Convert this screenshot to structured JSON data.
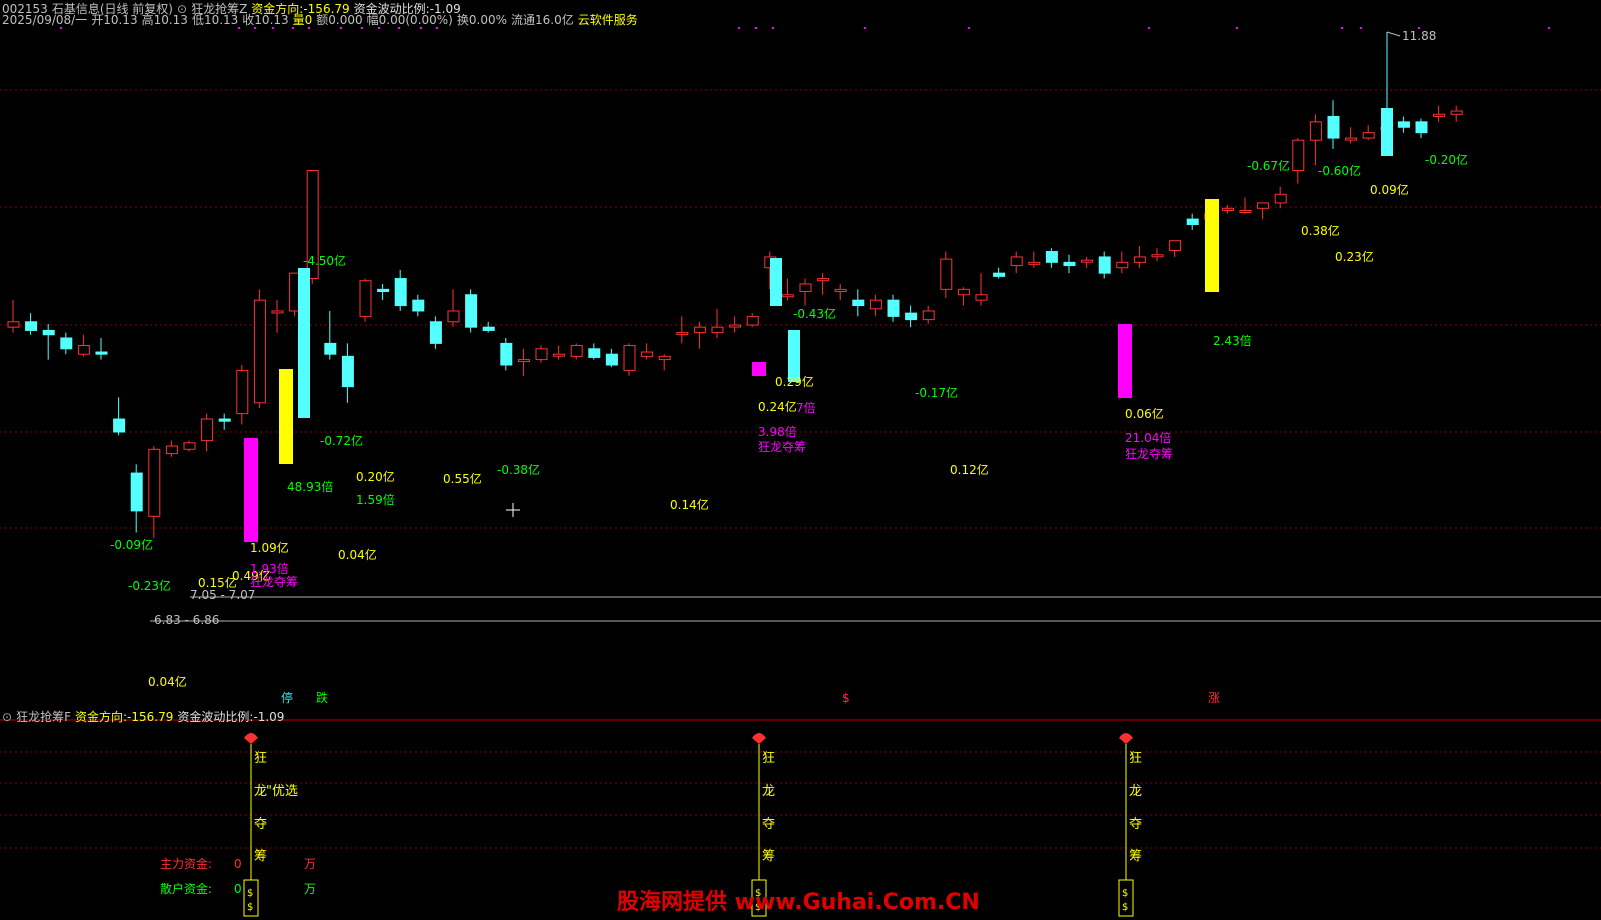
{
  "header": {
    "code": "002153",
    "name": "石基信息(日线 前复权)",
    "indicator": "狂龙抢筹Z",
    "fund_dir_label": "资金方向:",
    "fund_dir_value": "-156.79",
    "fund_wave_label": "资金波动比例:",
    "fund_wave_value": "-1.09",
    "date": "2025/09/08/一",
    "open": "开10.13",
    "high": "高10.13",
    "low": "低10.13",
    "close": "收10.13",
    "vol": "量0",
    "amount": "额0.000",
    "change": "幅0.00(0.00%)",
    "turnover": "换0.00%",
    "float": "流通16.0亿",
    "service": "云软件服务"
  },
  "sub_header": {
    "indicator": "狂龙抢筹F",
    "fund_dir_label": "资金方向:",
    "fund_dir_value": "-156.79",
    "fund_wave_label": "资金波动比例:",
    "fund_wave_value": "-1.09"
  },
  "price_labels": {
    "max": "11.88",
    "range_high": "7.05 - 7.07",
    "range_low": "6.83 - 6.86",
    "min_label": "0.04亿"
  },
  "annotations": [
    {
      "text": "-0.09亿",
      "color": "#00ff00"
    },
    {
      "text": "-0.23亿",
      "color": "#00ff00"
    },
    {
      "text": "0.15亿",
      "color": "#ffff00"
    },
    {
      "text": "0.49亿",
      "color": "#ffff00"
    },
    {
      "text": "1.09亿",
      "color": "#ffff00"
    },
    {
      "text": "1.93倍",
      "color": "#ff00ff"
    },
    {
      "text": "狂龙夺筹",
      "color": "#ff00ff"
    },
    {
      "text": "48.93倍",
      "color": "#00ff00"
    },
    {
      "text": "-4.50亿",
      "color": "#00ff00"
    },
    {
      "text": "-0.72亿",
      "color": "#00ff00"
    },
    {
      "text": "0.20亿",
      "color": "#ffff00"
    },
    {
      "text": "1.59倍",
      "color": "#00ff00"
    },
    {
      "text": "0.04亿",
      "color": "#ffff00"
    },
    {
      "text": "0.55亿",
      "color": "#ffff00"
    },
    {
      "text": "-0.38亿",
      "color": "#00ff00"
    },
    {
      "text": "0.14亿",
      "color": "#ffff00"
    },
    {
      "text": "-0.43亿",
      "color": "#00ff00"
    },
    {
      "text": "0.29亿",
      "color": "#ffff00"
    },
    {
      "text": "0.24亿",
      "color": "#ffff00"
    },
    {
      "text": "7倍",
      "color": "#ff00ff"
    },
    {
      "text": "3.98倍",
      "color": "#ff00ff"
    },
    {
      "text": "狂龙夺筹",
      "color": "#ff00ff"
    },
    {
      "text": "-0.17亿",
      "color": "#00ff00"
    },
    {
      "text": "0.12亿",
      "color": "#ffff00"
    },
    {
      "text": "0.06亿",
      "color": "#ffff00"
    },
    {
      "text": "21.04倍",
      "color": "#ff00ff"
    },
    {
      "text": "狂龙夺筹",
      "color": "#ff00ff"
    },
    {
      "text": "2.43倍",
      "color": "#00ff00"
    },
    {
      "text": "-0.67亿",
      "color": "#00ff00"
    },
    {
      "text": "0.38亿",
      "color": "#ffff00"
    },
    {
      "text": "0.23亿",
      "color": "#ffff00"
    },
    {
      "text": "-0.60亿",
      "color": "#00ff00"
    },
    {
      "text": "0.09亿",
      "color": "#ffff00"
    },
    {
      "text": "-0.20亿",
      "color": "#00ff00"
    },
    {
      "text": "0.04亿",
      "color": "#ffff00"
    }
  ],
  "axis_marks": [
    {
      "text": "停",
      "color": "#40e0e0"
    },
    {
      "text": "跌",
      "color": "#00ff00"
    },
    {
      "text": "$",
      "color": "#ff3030"
    },
    {
      "text": "涨",
      "color": "#ff3030"
    }
  ],
  "signals": [
    {
      "chars": [
        "狂",
        "龙",
        "夺",
        "筹"
      ],
      "extra": "\"优选"
    },
    {
      "chars": [
        "狂",
        "龙",
        "夺",
        "筹"
      ],
      "extra": ""
    },
    {
      "chars": [
        "狂",
        "龙",
        "夺",
        "筹"
      ],
      "extra": ""
    }
  ],
  "funds": {
    "main_label": "主力资金:",
    "main_value": "0",
    "main_unit": "万",
    "retail_label": "散户资金:",
    "retail_value": "0",
    "retail_unit": "万"
  },
  "watermark": "股海网提供 www.Guhai.Com.CN",
  "colors": {
    "up": "#ff3232",
    "down": "#54ffff",
    "yellow": "#ffff00",
    "magenta": "#ff00ff",
    "grid": "#8b0000"
  },
  "candles": [
    [
      10.25,
      10.5,
      10.2,
      10.3
    ],
    [
      10.3,
      10.38,
      10.18,
      10.22
    ],
    [
      10.22,
      10.28,
      9.95,
      10.18
    ],
    [
      10.15,
      10.2,
      10.0,
      10.05
    ],
    [
      10.0,
      10.18,
      9.98,
      10.08
    ],
    [
      10.02,
      10.15,
      9.95,
      10.0
    ],
    [
      9.4,
      9.6,
      9.25,
      9.28
    ],
    [
      8.9,
      8.98,
      8.35,
      8.55
    ],
    [
      8.5,
      9.15,
      8.3,
      9.12
    ],
    [
      9.08,
      9.2,
      9.05,
      9.15
    ],
    [
      9.12,
      9.2,
      9.1,
      9.18
    ],
    [
      9.2,
      9.45,
      9.1,
      9.4
    ],
    [
      9.4,
      9.45,
      9.3,
      9.38
    ],
    [
      9.45,
      9.9,
      9.35,
      9.85
    ],
    [
      9.55,
      10.6,
      9.5,
      10.5
    ],
    [
      10.4,
      10.5,
      10.2,
      10.4
    ],
    [
      10.4,
      10.75,
      10.35,
      10.75
    ],
    [
      10.7,
      11.7,
      10.65,
      11.7
    ],
    [
      10.1,
      10.4,
      9.95,
      10.0
    ],
    [
      9.98,
      10.1,
      9.55,
      9.7
    ],
    [
      10.35,
      10.7,
      10.3,
      10.68
    ],
    [
      10.6,
      10.65,
      10.5,
      10.58
    ],
    [
      10.7,
      10.78,
      10.4,
      10.45
    ],
    [
      10.5,
      10.55,
      10.35,
      10.4
    ],
    [
      10.3,
      10.35,
      10.05,
      10.1
    ],
    [
      10.3,
      10.6,
      10.25,
      10.4
    ],
    [
      10.55,
      10.6,
      10.2,
      10.25
    ],
    [
      10.25,
      10.3,
      10.2,
      10.22
    ],
    [
      10.1,
      10.15,
      9.85,
      9.9
    ],
    [
      9.95,
      10.05,
      9.8,
      9.95
    ],
    [
      9.95,
      10.08,
      9.92,
      10.05
    ],
    [
      10.0,
      10.08,
      9.95,
      10.0
    ],
    [
      9.98,
      10.1,
      9.95,
      10.08
    ],
    [
      10.05,
      10.1,
      9.95,
      9.97
    ],
    [
      10.0,
      10.05,
      9.88,
      9.9
    ],
    [
      9.85,
      10.1,
      9.8,
      10.08
    ],
    [
      9.98,
      10.1,
      9.95,
      10.02
    ],
    [
      9.95,
      10.0,
      9.85,
      9.98
    ],
    [
      10.2,
      10.35,
      10.1,
      10.2
    ],
    [
      10.2,
      10.3,
      10.05,
      10.25
    ],
    [
      10.2,
      10.42,
      10.15,
      10.25
    ],
    [
      10.27,
      10.35,
      10.2,
      10.27
    ],
    [
      10.27,
      10.38,
      10.25,
      10.35
    ],
    [
      10.8,
      10.95,
      10.6,
      10.9
    ],
    [
      10.55,
      10.7,
      10.5,
      10.55
    ],
    [
      10.58,
      10.7,
      10.45,
      10.65
    ],
    [
      10.68,
      10.75,
      10.55,
      10.7
    ],
    [
      10.58,
      10.65,
      10.5,
      10.6
    ],
    [
      10.5,
      10.6,
      10.35,
      10.45
    ],
    [
      10.42,
      10.55,
      10.35,
      10.5
    ],
    [
      10.5,
      10.55,
      10.3,
      10.35
    ],
    [
      10.38,
      10.45,
      10.25,
      10.32
    ],
    [
      10.32,
      10.45,
      10.28,
      10.4
    ],
    [
      10.6,
      10.95,
      10.52,
      10.88
    ],
    [
      10.55,
      10.62,
      10.45,
      10.6
    ],
    [
      10.5,
      10.75,
      10.45,
      10.55
    ],
    [
      10.75,
      10.8,
      10.7,
      10.72
    ],
    [
      10.82,
      10.95,
      10.75,
      10.9
    ],
    [
      10.85,
      10.95,
      10.8,
      10.85
    ],
    [
      10.95,
      10.98,
      10.8,
      10.85
    ],
    [
      10.85,
      10.92,
      10.75,
      10.82
    ],
    [
      10.87,
      10.9,
      10.8,
      10.87
    ],
    [
      10.9,
      10.95,
      10.7,
      10.75
    ],
    [
      10.8,
      10.95,
      10.75,
      10.85
    ],
    [
      10.85,
      11.0,
      10.8,
      10.9
    ],
    [
      10.92,
      10.98,
      10.86,
      10.92
    ],
    [
      10.96,
      11.05,
      10.9,
      11.05
    ],
    [
      11.25,
      11.3,
      11.15,
      11.2
    ],
    [
      11.25,
      11.35,
      11.15,
      11.3
    ],
    [
      11.33,
      11.38,
      11.3,
      11.35
    ],
    [
      11.32,
      11.45,
      11.3,
      11.33
    ],
    [
      11.35,
      11.4,
      11.25,
      11.4
    ],
    [
      11.4,
      11.55,
      11.35,
      11.48
    ],
    [
      11.7,
      12.0,
      11.58,
      11.98
    ],
    [
      11.98,
      12.22,
      11.75,
      12.15
    ],
    [
      12.2,
      12.35,
      11.9,
      12.0
    ],
    [
      12.0,
      12.1,
      11.95,
      12.0
    ],
    [
      12.0,
      12.12,
      11.98,
      12.05
    ],
    [
      12.1,
      12.2,
      12.05,
      12.1
    ],
    [
      12.15,
      12.2,
      12.05,
      12.1
    ],
    [
      12.15,
      12.18,
      12.0,
      12.05
    ],
    [
      12.2,
      12.3,
      12.15,
      12.22
    ],
    [
      12.22,
      12.3,
      12.15,
      12.25
    ]
  ]
}
